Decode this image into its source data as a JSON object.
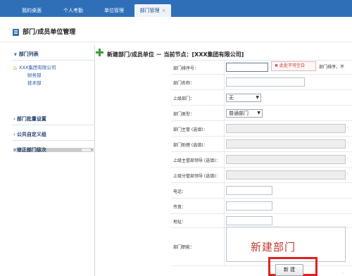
{
  "tabs": [
    {
      "label": "我的桌面"
    },
    {
      "label": "个人考勤"
    },
    {
      "label": "单位管理"
    },
    {
      "label": "部门管理",
      "close": "×"
    }
  ],
  "page_title": "部门/成员单位管理",
  "left_panel": {
    "dept_list_heading": "部门列表",
    "tree_root": "XXX集团有限公司",
    "tree_children": [
      "财务部",
      "技术部"
    ],
    "sections": [
      "部门批量设置",
      "公共自定义组",
      "修正部门级次"
    ]
  },
  "main": {
    "title": "新建部门/成员单位 － 当前节点：[XXX集团有限公司]",
    "fields": {
      "sort": {
        "label": "部门排序号："
      },
      "name": {
        "label": "部门名称："
      },
      "parent": {
        "label": "上级部门：",
        "value": "无"
      },
      "type": {
        "label": "部门类型：",
        "value": "普通部门"
      },
      "manager": {
        "label": "部门主管 (选填)："
      },
      "assistant": {
        "label": "部门助理 (选填)："
      },
      "superior_lead": {
        "label": "上级主管部领导 (选填)："
      },
      "superior_branch": {
        "label": "上级分管部领导 (选填)："
      },
      "phone": {
        "label": "电话："
      },
      "fax": {
        "label": "传真："
      },
      "address": {
        "label": "地址："
      },
      "duty": {
        "label": "部门职能："
      }
    },
    "error_tip": "此处不可空白",
    "sort_hint": "部门排序，不",
    "overlay_caption": "新建部门",
    "create_button": "新 建"
  },
  "colors": {
    "tab_bar": "#2f6fb8",
    "highlight": "#e02020",
    "caption": "#c0392b",
    "add_icon": "#3aa03a"
  }
}
